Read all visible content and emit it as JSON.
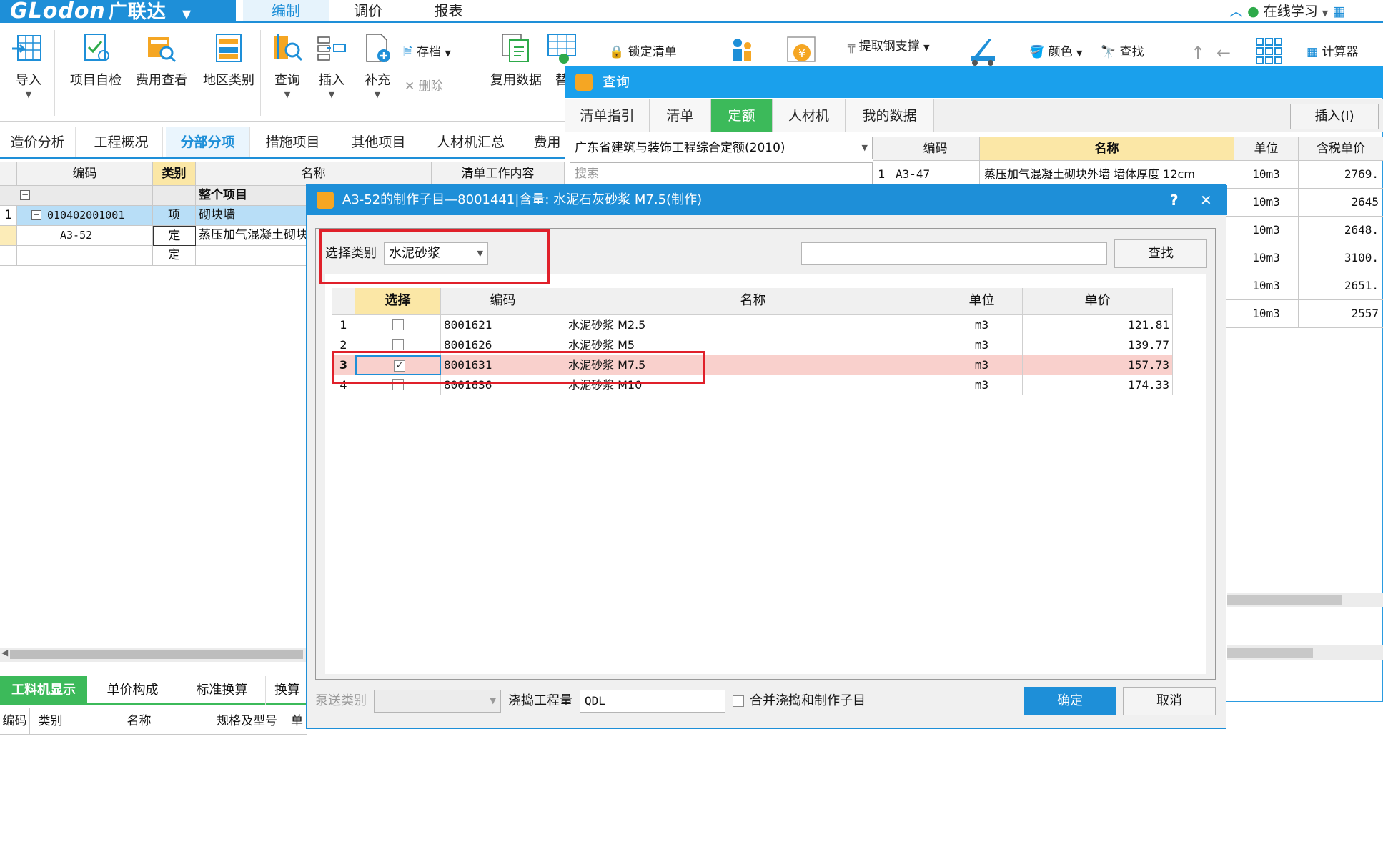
{
  "app": {
    "logo_en": "GLodon",
    "logo_cn": "广联达",
    "menu": [
      "编制",
      "调价",
      "报表"
    ],
    "online_learning": "在线学习"
  },
  "ribbon": {
    "buttons": [
      "导入",
      "项目自检",
      "费用查看",
      "地区类别",
      "查询",
      "插入",
      "补充",
      "复用数据",
      "替"
    ],
    "archive": "存档",
    "delete": "删除",
    "lock_list": "锁定清单",
    "extract_steel": "提取钢支撑",
    "color": "颜色",
    "find": "查找",
    "calculator": "计算器"
  },
  "nav_tabs": [
    "造价分析",
    "工程概况",
    "分部分项",
    "措施项目",
    "其他项目",
    "人材机汇总",
    "费用"
  ],
  "left_grid": {
    "headers": [
      "编码",
      "类别",
      "名称",
      "清单工作内容"
    ],
    "whole_project": "整个项目",
    "rows": [
      {
        "num": "1",
        "code": "010402001001",
        "type": "项",
        "name": "砌块墙"
      },
      {
        "num": "",
        "code": "A3-52",
        "type": "定",
        "name": "蒸压加气混凝土砌块"
      },
      {
        "num": "",
        "code": "",
        "type": "定",
        "name": ""
      }
    ]
  },
  "bottom_tabs": [
    "工料机显示",
    "单价构成",
    "标准换算",
    "换算"
  ],
  "bottom_headers": [
    "编码",
    "类别",
    "名称",
    "规格及型号",
    "单"
  ],
  "query_window": {
    "title": "查询",
    "tabs": [
      "清单指引",
      "清单",
      "定额",
      "人材机",
      "我的数据"
    ],
    "insert_button": "插入(I)",
    "quota_library": "广东省建筑与装饰工程综合定额(2010)",
    "search_placeholder": "搜索",
    "headers": [
      "编码",
      "名称",
      "单位",
      "含税单价"
    ],
    "rows": [
      {
        "num": "1",
        "code": "A3-47",
        "name": "蒸压加气混凝土砌块外墙 墙体厚度 12cm",
        "unit": "10m3",
        "price": "2769."
      },
      {
        "num": "",
        "code": "",
        "name": "",
        "unit": "10m3",
        "price": "2645"
      },
      {
        "num": "",
        "code": "",
        "name": "",
        "unit": "10m3",
        "price": "2648."
      },
      {
        "num": "",
        "code": "",
        "name": "",
        "unit": "10m3",
        "price": "3100."
      },
      {
        "num": "",
        "code": "",
        "name": "",
        "unit": "10m3",
        "price": "2651."
      },
      {
        "num": "",
        "code": "",
        "name": "",
        "unit": "10m3",
        "price": "2557"
      }
    ]
  },
  "dialog": {
    "title": "A3-52的制作子目—8001441|含量: 水泥石灰砂浆 M7.5(制作)",
    "help": "?",
    "close": "✕",
    "select_category_label": "选择类别",
    "select_category_value": "水泥砂浆",
    "search_button": "查找",
    "headers": [
      "选择",
      "编码",
      "名称",
      "单位",
      "单价"
    ],
    "rows": [
      {
        "num": "1",
        "checked": false,
        "code": "8001621",
        "name": "水泥砂浆 M2.5",
        "unit": "m3",
        "price": "121.81"
      },
      {
        "num": "2",
        "checked": false,
        "code": "8001626",
        "name": "水泥砂浆 M5",
        "unit": "m3",
        "price": "139.77"
      },
      {
        "num": "3",
        "checked": true,
        "code": "8001631",
        "name": "水泥砂浆 M7.5",
        "unit": "m3",
        "price": "157.73"
      },
      {
        "num": "4",
        "checked": false,
        "code": "8001636",
        "name": "水泥砂浆 M10",
        "unit": "m3",
        "price": "174.33"
      }
    ],
    "pump_label": "泵送类别",
    "pour_label": "浇捣工程量",
    "pour_value": "QDL",
    "merge_label": "合并浇捣和制作子目",
    "ok": "确定",
    "cancel": "取消"
  },
  "colors": {
    "accent": "#1e8fd8",
    "green_tab": "#3cba5a",
    "highlight_row": "#f9d0cc",
    "selected_row": "#b8def7",
    "annotation_red": "#e0202a"
  }
}
